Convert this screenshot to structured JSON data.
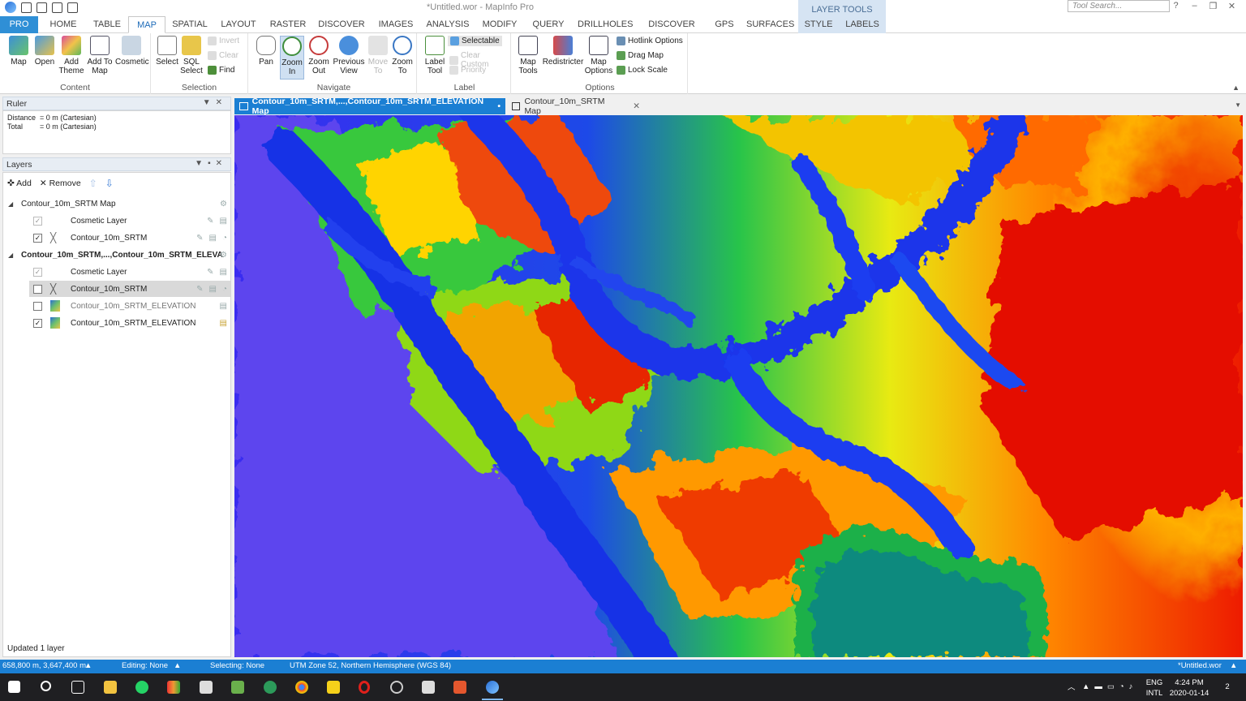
{
  "window": {
    "title": "*Untitled.wor - MapInfo Pro",
    "search_placeholder": "Tool Search...",
    "help": "?",
    "minimize": "–",
    "restore": "❐",
    "close": "✕"
  },
  "ribbon_tabs": [
    "PRO",
    "HOME",
    "TABLE",
    "MAP",
    "SPATIAL",
    "LAYOUT",
    "RASTER",
    "DISCOVER",
    "IMAGES",
    "ANALYSIS",
    "MODIFY",
    "QUERY",
    "DRILLHOLES",
    "DISCOVER 3D",
    "GPS",
    "SURFACES",
    "STYLE",
    "LABELS"
  ],
  "active_tab": "MAP",
  "layer_tools_title": "LAYER TOOLS",
  "ribbon": {
    "content": {
      "label": "Content",
      "map": "Map",
      "open": "Open",
      "add_theme_1": "Add",
      "add_theme_2": "Theme",
      "add_to_map_1": "Add To",
      "add_to_map_2": "Map",
      "cosmetic": "Cosmetic"
    },
    "selection": {
      "label": "Selection",
      "select": "Select",
      "sql_1": "SQL",
      "sql_2": "Select",
      "invert": "Invert",
      "clear": "Clear",
      "find": "Find"
    },
    "navigate": {
      "label": "Navigate",
      "pan": "Pan",
      "zoom_in_1": "Zoom",
      "zoom_in_2": "In",
      "zoom_out_1": "Zoom",
      "zoom_out_2": "Out",
      "prev_1": "Previous",
      "prev_2": "View",
      "move_1": "Move",
      "move_2": "To",
      "zoom_to_1": "Zoom",
      "zoom_to_2": "To"
    },
    "label": {
      "label": "Label",
      "tool_1": "Label",
      "tool_2": "Tool",
      "selectable": "Selectable",
      "clear_custom": "Clear Custom",
      "priority": "Priority"
    },
    "options": {
      "label": "Options",
      "map_tools_1": "Map",
      "map_tools_2": "Tools",
      "redistricter": "Redistricter",
      "map_options_1": "Map",
      "map_options_2": "Options",
      "hotlink": "Hotlink Options",
      "drag_map": "Drag Map",
      "lock_scale": "Lock Scale"
    }
  },
  "ruler": {
    "title": "Ruler",
    "distance_label": "Distance",
    "distance_value": "= 0 m (Cartesian)",
    "total_label": "Total",
    "total_value": "= 0 m (Cartesian)"
  },
  "layers": {
    "title": "Layers",
    "add": "Add",
    "remove": "Remove",
    "map1_name": "Contour_10m_SRTM Map",
    "map1_cosmetic": "Cosmetic Layer",
    "map1_contour": "Contour_10m_SRTM",
    "map2_name": "Contour_10m_SRTM,...,Contour_10m_SRTM_ELEVA",
    "map2_cosmetic": "Cosmetic Layer",
    "map2_contour": "Contour_10m_SRTM",
    "map2_elev_a": "Contour_10m_SRTM_ELEVATION",
    "map2_elev_b": "Contour_10m_SRTM_ELEVATION",
    "status": "Updated 1 layer"
  },
  "map_tabs": {
    "active": "Contour_10m_SRTM,...,Contour_10m_SRTM_ELEVATION Map",
    "other": "Contour_10m_SRTM Map"
  },
  "statusbar": {
    "coords": "658,800 m, 3,647,400 m",
    "editing": "Editing: None",
    "selecting": "Selecting: None",
    "projection": "UTM Zone 52, Northern Hemisphere (WGS 84)",
    "workspace": "*Untitled.wor"
  },
  "taskbar": {
    "lang_1": "ENG",
    "lang_2": "INTL",
    "time": "4:24 PM",
    "date": "2020-01-14",
    "notif_count": "2"
  }
}
